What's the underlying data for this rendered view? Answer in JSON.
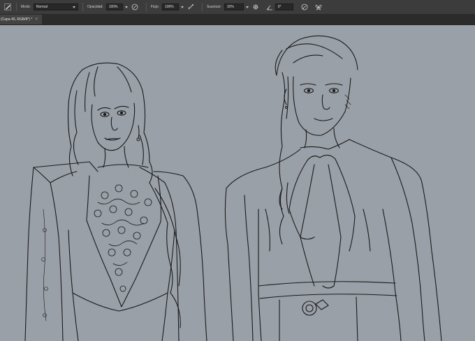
{
  "options_bar": {
    "tool_icon": "brush-icon",
    "mode_label": "Modo:",
    "mode_value": "Normal",
    "opacity_label": "Opacidad:",
    "opacity_value": "100%",
    "pressure_opacity_icon": "pen-pressure-icon",
    "flow_label": "Flujo:",
    "flow_value": "100%",
    "airbrush_icon": "airbrush-icon",
    "smoothing_label": "Suavizar:",
    "smoothing_value": "10%",
    "settings_icon": "gear-icon",
    "angle_icon": "angle-icon",
    "angle_value": "0°",
    "pressure_size_icon": "pen-pressure-size-icon",
    "symmetry_icon": "butterfly-icon"
  },
  "document_tab": {
    "title": "(Capa 40, RGB/8*) *",
    "close_glyph": "×"
  },
  "colors": {
    "canvas_bg": "#9aa0a8",
    "toolbar_bg": "#3c3c3c",
    "line_art": "#1a1a1a"
  }
}
